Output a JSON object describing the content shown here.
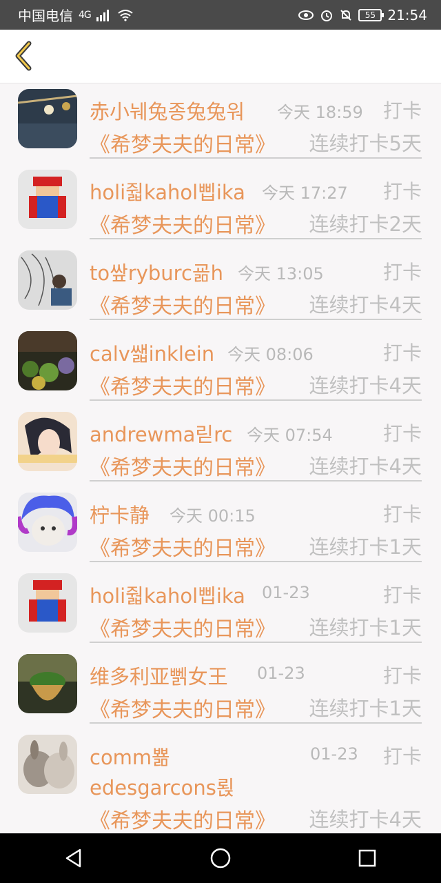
{
  "status": {
    "carrier": "中国电信",
    "network": "4G",
    "battery": "55",
    "time": "21:54"
  },
  "items": [
    {
      "name": "赤小눼兔종兔兔워",
      "time": "今天 18:59",
      "action": "打卡",
      "book": "《希梦夫夫的日常》",
      "streak": "连续打卡5天",
      "avatar_color": "#2d3b4a"
    },
    {
      "name": "holi줣kahol삡ika",
      "time": "今天 17:27",
      "action": "打卡",
      "book": "《希梦夫夫的日常》",
      "streak": "连续打卡2天",
      "avatar_color": "#e4e4e4"
    },
    {
      "name": "to쌒ryburc굚h",
      "time": "今天 13:05",
      "action": "打卡",
      "book": "《希梦夫夫的日常》",
      "streak": "连续打卡4天",
      "avatar_color": "#d9d9d9"
    },
    {
      "name": "calv쌟inklein",
      "time": "今天 08:06",
      "action": "打卡",
      "book": "《希梦夫夫的日常》",
      "streak": "连续打卡4天",
      "avatar_color": "#3a4a2a"
    },
    {
      "name": "andrewma릳rc",
      "time": "今天 07:54",
      "action": "打卡",
      "book": "《希梦夫夫的日常》",
      "streak": "连续打卡4天",
      "avatar_color": "#eed9c4"
    },
    {
      "name": "柠卡静",
      "time": "今天 00:15",
      "action": "打卡",
      "book": "《希梦夫夫的日常》",
      "streak": "连续打卡1天",
      "avatar_color": "#6a6fe0"
    },
    {
      "name": "holi줣kahol삡ika",
      "time": "01-23",
      "action": "打卡",
      "book": "《希梦夫夫的日常》",
      "streak": "连续打卡1天",
      "avatar_color": "#e4e4e4"
    },
    {
      "name": "维多利亚뻵女王",
      "time": "01-23",
      "action": "打卡",
      "book": "《希梦夫夫的日常》",
      "streak": "连续打卡1天",
      "avatar_color": "#5a6b3a"
    },
    {
      "name": "comm뾺",
      "name2": "edesgarcons뢵",
      "time": "01-23",
      "action": "打卡",
      "book": "《希梦夫夫的日常》",
      "streak": "连续打卡4天",
      "avatar_color": "#dcd6d0"
    }
  ]
}
